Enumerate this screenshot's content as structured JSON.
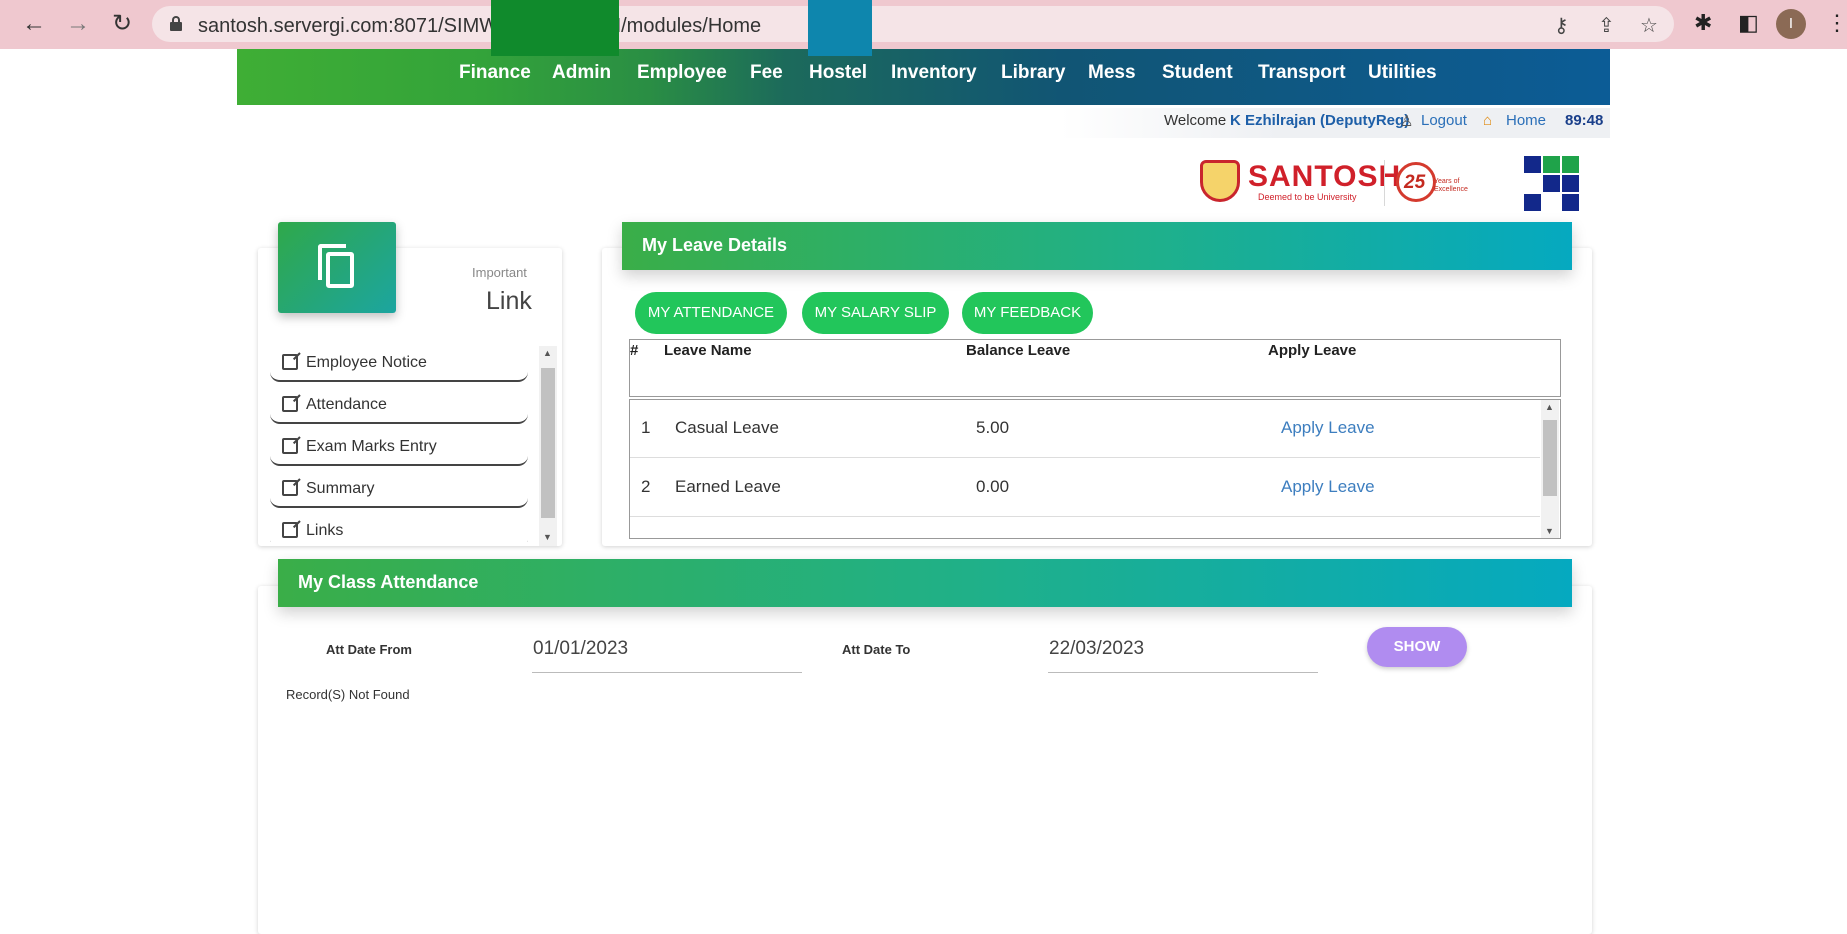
{
  "browser": {
    "url": "santosh.servergi.com:8071/SIMWEBSANTOSH/modules/Home",
    "avatar_initial": "I"
  },
  "nav": {
    "items": [
      "Finance",
      "Admin",
      "Employee",
      "Fee",
      "Hostel",
      "Inventory",
      "Library",
      "Mess",
      "Student",
      "Transport",
      "Utilities"
    ]
  },
  "user_bar": {
    "welcome_label": "Welcome",
    "user_name": "K Ezhilrajan (DeputyReg)",
    "logout_label": "Logout",
    "home_label": "Home",
    "timer": "89:48"
  },
  "branding": {
    "name": "SANTOSH",
    "tagline": "Deemed to be University",
    "anniversary": "25",
    "anniversary_tail": "Years of Excellence"
  },
  "links_panel": {
    "small_title": "Important",
    "title": "Link",
    "items": [
      "Employee Notice",
      "Attendance",
      "Exam Marks Entry",
      "Summary",
      "Links"
    ]
  },
  "leave_details": {
    "title": "My Leave Details",
    "buttons": [
      "MY ATTENDANCE",
      "MY SALARY SLIP",
      "MY FEEDBACK"
    ],
    "columns": [
      "#",
      "Leave Name",
      "Balance Leave",
      "Apply Leave"
    ],
    "rows": [
      {
        "num": "1",
        "name": "Casual Leave",
        "balance": "5.00",
        "action": "Apply Leave"
      },
      {
        "num": "2",
        "name": "Earned Leave",
        "balance": "0.00",
        "action": "Apply Leave"
      }
    ]
  },
  "class_attendance": {
    "title": "My Class Attendance",
    "from_label": "Att Date From",
    "from_value": "01/01/2023",
    "to_label": "Att Date To",
    "to_value": "22/03/2023",
    "show_label": "SHOW",
    "empty_message": "Record(S) Not Found"
  },
  "colors": {
    "chrome_bg": "#efc8cf",
    "accent_green": "#22c65b",
    "show_button": "#b08cf0",
    "link_blue": "#3d7ebf",
    "brand_red": "#d0202a"
  }
}
